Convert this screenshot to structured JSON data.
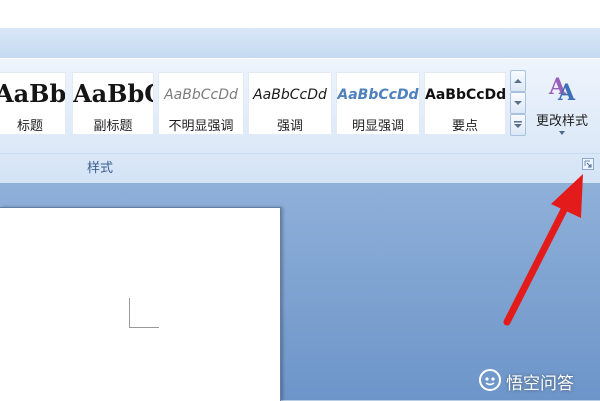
{
  "ribbon": {
    "styles_group": {
      "label": "样式",
      "gallery": [
        {
          "sample": "AaBbC",
          "caption": "标题"
        },
        {
          "sample": "AaBbC",
          "caption": "副标题"
        },
        {
          "sample": "AaBbCcDd",
          "caption": "不明显强调"
        },
        {
          "sample": "AaBbCcDd",
          "caption": "强调"
        },
        {
          "sample": "AaBbCcDd",
          "caption": "明显强调"
        },
        {
          "sample": "AaBbCcDd",
          "caption": "要点"
        }
      ],
      "change_styles_label": "更改样式"
    }
  },
  "icons": {
    "gallery_up": "chevron-up-icon",
    "gallery_down": "chevron-down-icon",
    "gallery_more": "more-icon",
    "change_styles": "change-styles-icon",
    "dialog_launcher": "dialog-launcher-icon",
    "annotation": "red-arrow"
  },
  "colors": {
    "intense_emphasis_text": "#4f81bd",
    "subtle_emphasis_text": "#7c7c7c",
    "annotation_arrow": "#e41b1b"
  },
  "watermark": {
    "text": "悟空问答"
  }
}
